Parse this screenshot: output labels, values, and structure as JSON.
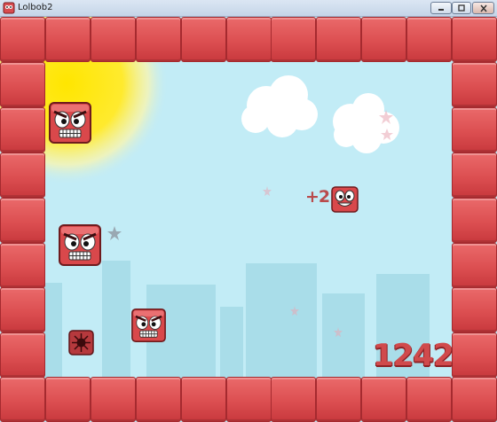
{
  "window": {
    "title": "Lolbob2",
    "buttons": {
      "minimize_icon": "minimize-icon",
      "maximize_icon": "maximize-icon",
      "close_icon": "close-icon"
    }
  },
  "game": {
    "score": "1242",
    "bonus_popup": "+2",
    "colors": {
      "sky": "#c2ecf6",
      "sun": "#ffe600",
      "wall_tile": "#dc4f51",
      "city_silhouette": "#a9dde9",
      "score_text": "#d04a4c"
    },
    "icons": {
      "player": "smiling-red-block-icon",
      "enemy": "angry-red-block-icon",
      "spike": "spiked-mine-icon",
      "star": "star-icon",
      "cloud": "cloud-icon",
      "sun": "sun-icon"
    }
  }
}
